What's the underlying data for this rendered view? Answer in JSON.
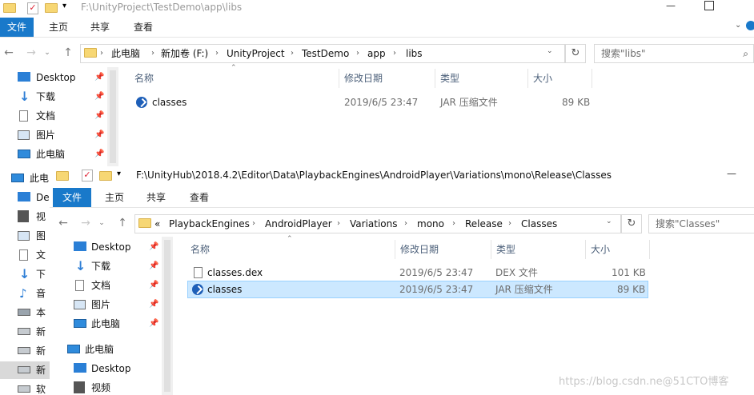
{
  "back_window": {
    "title_path": "F:\\UnityProject\\TestDemo\\app\\libs",
    "tabs": [
      "文件",
      "主页",
      "共享",
      "查看"
    ],
    "breadcrumb": [
      "此电脑",
      "新加卷 (F:)",
      "UnityProject",
      "TestDemo",
      "app",
      "libs"
    ],
    "search_placeholder": "搜索\"libs\"",
    "sidebar": [
      {
        "label": "Desktop",
        "icon": "desktop-icon"
      },
      {
        "label": "下载",
        "icon": "download-icon"
      },
      {
        "label": "文档",
        "icon": "document-icon"
      },
      {
        "label": "图片",
        "icon": "picture-icon"
      },
      {
        "label": "此电脑",
        "icon": "computer-icon"
      }
    ],
    "sidebar_partial": [
      "此电",
      "De",
      "视",
      "图",
      "文",
      "下",
      "音",
      "本",
      "新",
      "新",
      "新",
      "软"
    ],
    "columns": [
      "名称",
      "修改日期",
      "类型",
      "大小"
    ],
    "files": [
      {
        "name": "classes",
        "date": "2019/6/5 23:47",
        "type": "JAR 压缩文件",
        "size": "89 KB",
        "icon": "jar-icon"
      }
    ]
  },
  "front_window": {
    "title_path": "F:\\UnityHub\\2018.4.2\\Editor\\Data\\PlaybackEngines\\AndroidPlayer\\Variations\\mono\\Release\\Classes",
    "tabs": [
      "文件",
      "主页",
      "共享",
      "查看"
    ],
    "breadcrumb_prefix": "«",
    "breadcrumb": [
      "PlaybackEngines",
      "AndroidPlayer",
      "Variations",
      "mono",
      "Release",
      "Classes"
    ],
    "search_placeholder": "搜索\"Classes\"",
    "sidebar": [
      {
        "label": "Desktop",
        "icon": "desktop-icon"
      },
      {
        "label": "下载",
        "icon": "download-icon"
      },
      {
        "label": "文档",
        "icon": "document-icon"
      },
      {
        "label": "图片",
        "icon": "picture-icon"
      },
      {
        "label": "此电脑",
        "icon": "computer-icon"
      },
      {
        "label": "此电脑",
        "icon": "computer-icon"
      },
      {
        "label": "Desktop",
        "icon": "desktop-icon"
      },
      {
        "label": "视频",
        "icon": "video-icon"
      }
    ],
    "columns": [
      "名称",
      "修改日期",
      "类型",
      "大小"
    ],
    "files": [
      {
        "name": "classes.dex",
        "date": "2019/6/5 23:47",
        "type": "DEX 文件",
        "size": "101 KB",
        "icon": "file-icon"
      },
      {
        "name": "classes",
        "date": "2019/6/5 23:47",
        "type": "JAR 压缩文件",
        "size": "89 KB",
        "icon": "jar-icon",
        "selected": true
      }
    ]
  },
  "watermark": "https://blog.csdn.ne@51CTO博客",
  "colors": {
    "accent": "#1979ca",
    "selection": "#cce8ff",
    "selection_border": "#99d1ff"
  }
}
